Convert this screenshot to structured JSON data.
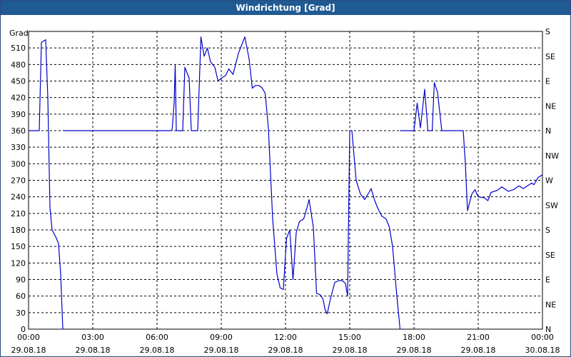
{
  "window": {
    "title": "Windrichtung [Grad]"
  },
  "chart_data": {
    "type": "line",
    "title": "Windrichtung [Grad]",
    "ylabel": "Grad",
    "ylim": [
      0,
      540
    ],
    "yticks": [
      0,
      30,
      60,
      90,
      120,
      150,
      180,
      210,
      240,
      270,
      300,
      330,
      360,
      390,
      420,
      450,
      480,
      510
    ],
    "right_axis_labels": [
      {
        "value": 0,
        "label": "N"
      },
      {
        "value": 45,
        "label": "NE"
      },
      {
        "value": 90,
        "label": "E"
      },
      {
        "value": 135,
        "label": "SE"
      },
      {
        "value": 180,
        "label": "S"
      },
      {
        "value": 225,
        "label": "SW"
      },
      {
        "value": 270,
        "label": "W"
      },
      {
        "value": 315,
        "label": "NW"
      },
      {
        "value": 360,
        "label": "N"
      },
      {
        "value": 405,
        "label": "NE"
      },
      {
        "value": 450,
        "label": "E"
      },
      {
        "value": 495,
        "label": "SE"
      },
      {
        "value": 540,
        "label": "S"
      }
    ],
    "xlim_hours": [
      0,
      24
    ],
    "xticks": [
      {
        "hour": 0,
        "time": "00:00",
        "date": "29.08.18"
      },
      {
        "hour": 3,
        "time": "03:00",
        "date": "29.08.18"
      },
      {
        "hour": 6,
        "time": "06:00",
        "date": "29.08.18"
      },
      {
        "hour": 9,
        "time": "09:00",
        "date": "29.08.18"
      },
      {
        "hour": 12,
        "time": "12:00",
        "date": "29.08.18"
      },
      {
        "hour": 15,
        "time": "15:00",
        "date": "29.08.18"
      },
      {
        "hour": 18,
        "time": "18:00",
        "date": "29.08.18"
      },
      {
        "hour": 21,
        "time": "21:00",
        "date": "29.08.18"
      },
      {
        "hour": 24,
        "time": "00:00",
        "date": "30.08.18"
      }
    ],
    "grid": true,
    "line_color": "#0000cc",
    "series": [
      {
        "segments": [
          [
            [
              0,
              360
            ],
            [
              0.5,
              360
            ],
            [
              0.6,
              520
            ],
            [
              0.8,
              525
            ],
            [
              0.9,
              420
            ],
            [
              1.0,
              220
            ],
            [
              1.1,
              180
            ],
            [
              1.3,
              165
            ],
            [
              1.4,
              155
            ],
            [
              1.5,
              100
            ],
            [
              1.6,
              0
            ]
          ],
          [
            [
              1.6,
              360
            ],
            [
              6.7,
              360
            ],
            [
              6.8,
              410
            ],
            [
              6.85,
              480
            ],
            [
              6.9,
              360
            ],
            [
              7.2,
              360
            ],
            [
              7.3,
              475
            ],
            [
              7.5,
              455
            ],
            [
              7.6,
              360
            ],
            [
              7.9,
              360
            ],
            [
              8.05,
              530
            ],
            [
              8.2,
              495
            ],
            [
              8.35,
              510
            ],
            [
              8.5,
              485
            ],
            [
              8.7,
              475
            ],
            [
              8.85,
              450
            ],
            [
              9.0,
              455
            ],
            [
              9.2,
              460
            ],
            [
              9.35,
              472
            ],
            [
              9.55,
              462
            ],
            [
              9.8,
              500
            ],
            [
              10.1,
              530
            ],
            [
              10.3,
              490
            ],
            [
              10.45,
              437
            ],
            [
              10.6,
              442
            ],
            [
              10.75,
              442
            ],
            [
              10.9,
              438
            ],
            [
              11.05,
              428
            ],
            [
              11.2,
              365
            ],
            [
              11.4,
              200
            ],
            [
              11.6,
              100
            ],
            [
              11.75,
              75
            ],
            [
              11.9,
              72
            ],
            [
              12.05,
              165
            ],
            [
              12.2,
              180
            ],
            [
              12.35,
              90
            ],
            [
              12.5,
              175
            ],
            [
              12.65,
              195
            ],
            [
              12.85,
              200
            ],
            [
              13.0,
              220
            ],
            [
              13.1,
              235
            ],
            [
              13.3,
              185
            ],
            [
              13.45,
              65
            ],
            [
              13.6,
              63
            ],
            [
              13.75,
              55
            ],
            [
              13.85,
              35
            ],
            [
              13.95,
              28
            ],
            [
              14.1,
              55
            ],
            [
              14.3,
              85
            ],
            [
              14.5,
              88
            ],
            [
              14.65,
              88
            ],
            [
              14.8,
              83
            ],
            [
              14.9,
              60
            ],
            [
              15.0,
              360
            ],
            [
              15.1,
              360
            ],
            [
              15.3,
              270
            ],
            [
              15.5,
              245
            ],
            [
              15.7,
              235
            ],
            [
              15.9,
              248
            ],
            [
              16.0,
              255
            ],
            [
              16.15,
              235
            ],
            [
              16.3,
              220
            ],
            [
              16.5,
              205
            ],
            [
              16.7,
              200
            ],
            [
              16.85,
              185
            ],
            [
              17.0,
              150
            ],
            [
              17.2,
              60
            ],
            [
              17.35,
              0
            ]
          ],
          [
            [
              17.35,
              360
            ],
            [
              18.0,
              360
            ],
            [
              18.15,
              410
            ],
            [
              18.3,
              365
            ],
            [
              18.5,
              435
            ],
            [
              18.65,
              360
            ],
            [
              18.85,
              360
            ],
            [
              18.95,
              447
            ],
            [
              19.1,
              430
            ],
            [
              19.3,
              360
            ],
            [
              20.3,
              360
            ],
            [
              20.4,
              300
            ],
            [
              20.5,
              215
            ],
            [
              20.7,
              245
            ],
            [
              20.85,
              253
            ],
            [
              21.0,
              240
            ],
            [
              21.3,
              238
            ],
            [
              21.45,
              233
            ],
            [
              21.6,
              248
            ],
            [
              21.9,
              252
            ],
            [
              22.1,
              258
            ],
            [
              22.4,
              250
            ],
            [
              22.65,
              253
            ],
            [
              22.9,
              260
            ],
            [
              23.1,
              255
            ],
            [
              23.3,
              260
            ],
            [
              23.5,
              265
            ],
            [
              23.6,
              262
            ],
            [
              23.8,
              275
            ],
            [
              24.0,
              280
            ]
          ]
        ]
      }
    ]
  }
}
